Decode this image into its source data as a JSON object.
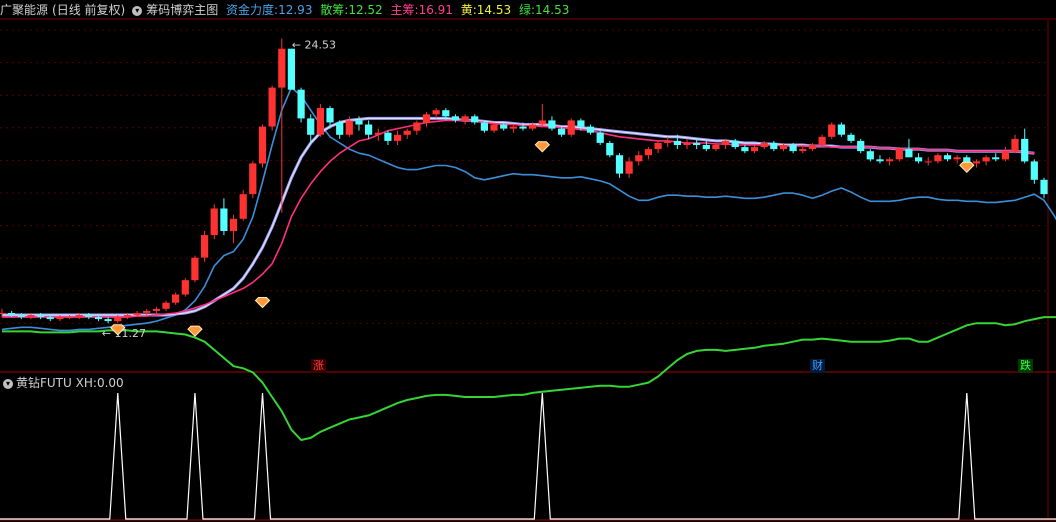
{
  "header": {
    "stock_name": "广聚能源",
    "period": "(日线 前复权)",
    "indicator_name": "筹码博弈主图",
    "fund_power_label": "资金力度:",
    "fund_power_value": "12.93",
    "retail_label": "散筹:",
    "retail_value": "12.52",
    "main_label": "主筹:",
    "main_value": "16.91",
    "yellow_label": "黄:",
    "yellow_value": "14.53",
    "green_label": "绿:",
    "green_value": "14.53",
    "colors": {
      "stock": "#d0d0d0",
      "indicator": "#d0d0d0",
      "fund": "#4aa3e8",
      "retail": "#3fe03f",
      "main": "#ff3f8f",
      "yellow": "#f0f03c",
      "green": "#3fe03f"
    }
  },
  "subheader": {
    "name": "黄钻FUTU",
    "xh_label": "XH:",
    "xh_value": "0.00"
  },
  "events": [
    {
      "label": "涨",
      "color": "#ff4040",
      "bg": "#3a0000"
    },
    {
      "label": "财",
      "color": "#40a0ff",
      "bg": "#001a3a"
    },
    {
      "label": "跌",
      "color": "#40ff40",
      "bg": "#003a00"
    }
  ],
  "chart_data": {
    "type": "line",
    "price_range": [
      9.5,
      26.0
    ],
    "annotations": [
      {
        "text": "24.53",
        "series": "high"
      },
      {
        "text": "11.27",
        "series": "low"
      }
    ],
    "candles": [
      [
        11.6,
        11.8,
        11.4,
        11.6
      ],
      [
        11.6,
        11.7,
        11.4,
        11.5
      ],
      [
        11.5,
        11.6,
        11.3,
        11.4
      ],
      [
        11.4,
        11.6,
        11.3,
        11.5
      ],
      [
        11.5,
        11.6,
        11.3,
        11.4
      ],
      [
        11.4,
        11.5,
        11.2,
        11.3
      ],
      [
        11.3,
        11.5,
        11.2,
        11.4
      ],
      [
        11.4,
        11.5,
        11.3,
        11.4
      ],
      [
        11.4,
        11.6,
        11.3,
        11.5
      ],
      [
        11.5,
        11.6,
        11.3,
        11.4
      ],
      [
        11.4,
        11.5,
        11.2,
        11.3
      ],
      [
        11.3,
        11.4,
        11.1,
        11.2
      ],
      [
        11.2,
        11.5,
        11.1,
        11.4
      ],
      [
        11.4,
        11.6,
        11.3,
        11.5
      ],
      [
        11.5,
        11.7,
        11.4,
        11.6
      ],
      [
        11.6,
        11.8,
        11.5,
        11.7
      ],
      [
        11.7,
        11.9,
        11.5,
        11.8
      ],
      [
        11.8,
        12.2,
        11.7,
        12.1
      ],
      [
        12.1,
        12.6,
        12.0,
        12.5
      ],
      [
        12.5,
        13.3,
        12.4,
        13.2
      ],
      [
        13.2,
        14.4,
        13.1,
        14.3
      ],
      [
        14.3,
        15.6,
        14.1,
        15.4
      ],
      [
        15.4,
        16.9,
        15.2,
        16.7
      ],
      [
        16.7,
        17.2,
        15.4,
        15.6
      ],
      [
        15.6,
        16.4,
        15.0,
        16.2
      ],
      [
        16.2,
        17.6,
        16.1,
        17.4
      ],
      [
        17.4,
        19.0,
        17.2,
        18.9
      ],
      [
        18.9,
        20.8,
        18.7,
        20.7
      ],
      [
        20.7,
        22.7,
        20.5,
        22.6
      ],
      [
        22.6,
        25.0,
        16.5,
        24.5
      ],
      [
        24.5,
        24.5,
        22.5,
        22.5
      ],
      [
        22.5,
        22.6,
        20.9,
        21.1
      ],
      [
        21.1,
        21.3,
        19.9,
        20.3
      ],
      [
        20.3,
        21.8,
        20.2,
        21.6
      ],
      [
        21.6,
        21.7,
        20.6,
        20.9
      ],
      [
        20.9,
        21.0,
        20.1,
        20.3
      ],
      [
        20.3,
        21.2,
        20.2,
        21.0
      ],
      [
        21.0,
        21.2,
        20.5,
        20.8
      ],
      [
        20.8,
        21.0,
        20.1,
        20.3
      ],
      [
        20.3,
        20.6,
        20.0,
        20.4
      ],
      [
        20.4,
        20.5,
        19.8,
        20.0
      ],
      [
        20.0,
        20.5,
        19.8,
        20.3
      ],
      [
        20.3,
        20.6,
        20.1,
        20.5
      ],
      [
        20.5,
        21.0,
        20.3,
        20.9
      ],
      [
        20.9,
        21.4,
        20.7,
        21.3
      ],
      [
        21.3,
        21.6,
        21.1,
        21.5
      ],
      [
        21.5,
        21.6,
        21.0,
        21.2
      ],
      [
        21.2,
        21.3,
        20.9,
        21.0
      ],
      [
        21.0,
        21.3,
        20.8,
        21.2
      ],
      [
        21.2,
        21.3,
        20.8,
        20.9
      ],
      [
        20.9,
        21.0,
        20.4,
        20.5
      ],
      [
        20.5,
        20.9,
        20.4,
        20.8
      ],
      [
        20.8,
        20.9,
        20.5,
        20.6
      ],
      [
        20.6,
        20.8,
        20.4,
        20.7
      ],
      [
        20.7,
        20.9,
        20.5,
        20.6
      ],
      [
        20.6,
        20.9,
        20.5,
        20.8
      ],
      [
        20.8,
        21.8,
        20.7,
        21.0
      ],
      [
        21.0,
        21.2,
        20.5,
        20.6
      ],
      [
        20.6,
        20.7,
        20.2,
        20.3
      ],
      [
        20.3,
        21.1,
        20.2,
        21.0
      ],
      [
        21.0,
        21.1,
        20.5,
        20.7
      ],
      [
        20.7,
        20.8,
        20.3,
        20.4
      ],
      [
        20.4,
        20.5,
        19.8,
        19.9
      ],
      [
        19.9,
        20.0,
        19.2,
        19.3
      ],
      [
        19.3,
        19.4,
        18.2,
        18.4
      ],
      [
        18.4,
        19.2,
        18.2,
        19.0
      ],
      [
        19.0,
        19.5,
        18.8,
        19.3
      ],
      [
        19.3,
        19.7,
        19.1,
        19.6
      ],
      [
        19.6,
        20.0,
        19.4,
        19.9
      ],
      [
        19.9,
        20.2,
        19.7,
        20.0
      ],
      [
        20.0,
        20.3,
        19.6,
        19.8
      ],
      [
        19.8,
        20.1,
        19.6,
        19.9
      ],
      [
        19.9,
        20.1,
        19.6,
        19.8
      ],
      [
        19.8,
        20.0,
        19.5,
        19.6
      ],
      [
        19.6,
        19.9,
        19.5,
        19.8
      ],
      [
        19.8,
        20.1,
        19.6,
        20.0
      ],
      [
        20.0,
        20.1,
        19.6,
        19.7
      ],
      [
        19.7,
        19.8,
        19.4,
        19.5
      ],
      [
        19.5,
        19.8,
        19.4,
        19.7
      ],
      [
        19.7,
        20.0,
        19.6,
        19.9
      ],
      [
        19.9,
        20.0,
        19.5,
        19.6
      ],
      [
        19.6,
        19.9,
        19.5,
        19.8
      ],
      [
        19.8,
        19.9,
        19.4,
        19.5
      ],
      [
        19.5,
        19.8,
        19.4,
        19.6
      ],
      [
        19.6,
        19.9,
        19.5,
        19.8
      ],
      [
        19.8,
        20.3,
        19.7,
        20.2
      ],
      [
        20.2,
        20.9,
        20.1,
        20.8
      ],
      [
        20.8,
        20.9,
        20.2,
        20.3
      ],
      [
        20.3,
        20.4,
        19.9,
        20.0
      ],
      [
        20.0,
        20.1,
        19.4,
        19.5
      ],
      [
        19.5,
        19.6,
        19.0,
        19.1
      ],
      [
        19.1,
        19.3,
        18.9,
        19.0
      ],
      [
        19.0,
        19.2,
        18.8,
        19.1
      ],
      [
        19.1,
        19.7,
        19.0,
        19.6
      ],
      [
        19.6,
        20.1,
        19.5,
        19.2
      ],
      [
        19.2,
        19.4,
        18.9,
        19.0
      ],
      [
        19.0,
        19.2,
        18.8,
        19.0
      ],
      [
        19.0,
        19.4,
        18.9,
        19.3
      ],
      [
        19.3,
        19.4,
        19.0,
        19.1
      ],
      [
        19.1,
        19.3,
        18.9,
        19.2
      ],
      [
        19.2,
        19.3,
        18.8,
        18.9
      ],
      [
        18.9,
        19.1,
        18.7,
        19.0
      ],
      [
        19.0,
        19.3,
        18.8,
        19.2
      ],
      [
        19.2,
        19.4,
        19.0,
        19.1
      ],
      [
        19.1,
        19.7,
        19.0,
        19.5
      ],
      [
        19.5,
        20.3,
        19.4,
        20.1
      ],
      [
        20.1,
        20.6,
        18.9,
        19.0
      ],
      [
        19.0,
        19.1,
        17.9,
        18.1
      ],
      [
        18.1,
        18.2,
        17.2,
        17.4
      ]
    ],
    "series": [
      {
        "name": "资金力度",
        "color": "#3d8ed8",
        "values": [
          10.8,
          10.85,
          10.9,
          10.9,
          10.85,
          10.8,
          10.75,
          10.75,
          10.8,
          10.8,
          10.85,
          10.9,
          10.95,
          11.0,
          11.05,
          11.1,
          11.2,
          11.35,
          11.5,
          11.75,
          12.2,
          12.9,
          13.9,
          14.4,
          14.6,
          15.2,
          16.3,
          18.0,
          19.8,
          21.5,
          22.6,
          22.2,
          21.5,
          20.8,
          20.2,
          19.9,
          19.6,
          19.4,
          19.3,
          19.1,
          18.9,
          18.7,
          18.6,
          18.6,
          18.7,
          18.8,
          18.8,
          18.7,
          18.5,
          18.2,
          18.1,
          18.2,
          18.3,
          18.4,
          18.35,
          18.35,
          18.3,
          18.25,
          18.2,
          18.2,
          18.25,
          18.15,
          18.05,
          17.9,
          17.6,
          17.3,
          17.1,
          17.1,
          17.25,
          17.35,
          17.35,
          17.3,
          17.3,
          17.25,
          17.25,
          17.3,
          17.25,
          17.2,
          17.2,
          17.25,
          17.35,
          17.45,
          17.45,
          17.35,
          17.2,
          17.35,
          17.55,
          17.7,
          17.5,
          17.25,
          17.05,
          17.05,
          17.05,
          17.1,
          17.2,
          17.25,
          17.25,
          17.15,
          17.1,
          17.1,
          17.05,
          17.05,
          17.0,
          17.0,
          17.05,
          17.1,
          17.25,
          17.4,
          17.1,
          16.4,
          15.6
        ]
      },
      {
        "name": "散筹",
        "color": "#35d535",
        "values": [
          10.7,
          10.7,
          10.7,
          10.7,
          10.65,
          10.65,
          10.65,
          10.65,
          10.7,
          10.7,
          10.7,
          10.75,
          10.75,
          10.75,
          10.7,
          10.7,
          10.7,
          10.65,
          10.6,
          10.55,
          10.4,
          10.2,
          9.8,
          9.4,
          9.0,
          8.9,
          8.7,
          8.2,
          7.5,
          6.8,
          5.9,
          5.4,
          5.5,
          5.8,
          6.0,
          6.2,
          6.4,
          6.5,
          6.6,
          6.8,
          7.0,
          7.2,
          7.35,
          7.45,
          7.55,
          7.6,
          7.6,
          7.55,
          7.5,
          7.5,
          7.5,
          7.5,
          7.55,
          7.6,
          7.6,
          7.7,
          7.75,
          7.8,
          7.85,
          7.9,
          7.95,
          8.0,
          8.05,
          8.05,
          8.0,
          8.0,
          8.1,
          8.2,
          8.5,
          8.9,
          9.3,
          9.6,
          9.75,
          9.8,
          9.8,
          9.75,
          9.8,
          9.85,
          9.9,
          10.0,
          10.05,
          10.1,
          10.2,
          10.3,
          10.3,
          10.35,
          10.3,
          10.25,
          10.2,
          10.2,
          10.2,
          10.2,
          10.25,
          10.35,
          10.35,
          10.2,
          10.2,
          10.4,
          10.6,
          10.8,
          11.0,
          11.1,
          11.1,
          11.1,
          11.0,
          11.05,
          11.2,
          11.3,
          11.4,
          11.4,
          11.4,
          11.35,
          11.3,
          11.15,
          11.05,
          10.9,
          11.2,
          11.7,
          12.2,
          12.7
        ]
      },
      {
        "name": "主筹",
        "color": "#ff2f7f",
        "values": [
          11.4,
          11.4,
          11.4,
          11.4,
          11.4,
          11.4,
          11.4,
          11.4,
          11.4,
          11.4,
          11.4,
          11.4,
          11.4,
          11.4,
          11.45,
          11.45,
          11.5,
          11.55,
          11.6,
          11.7,
          11.85,
          12.0,
          12.2,
          12.4,
          12.6,
          12.8,
          13.1,
          13.5,
          14.0,
          15.0,
          16.3,
          17.2,
          17.9,
          18.5,
          19.0,
          19.4,
          19.7,
          20.0,
          20.1,
          20.3,
          20.5,
          20.6,
          20.7,
          20.8,
          20.9,
          20.95,
          21.0,
          21.0,
          21.0,
          20.95,
          20.9,
          20.85,
          20.8,
          20.8,
          20.75,
          20.75,
          20.7,
          20.7,
          20.65,
          20.6,
          20.55,
          20.5,
          20.4,
          20.3,
          20.2,
          20.15,
          20.1,
          20.05,
          20.0,
          20.0,
          19.95,
          19.9,
          19.9,
          19.9,
          19.85,
          19.85,
          19.8,
          19.8,
          19.8,
          19.8,
          19.8,
          19.75,
          19.75,
          19.75,
          19.75,
          19.75,
          19.7,
          19.7,
          19.7,
          19.7,
          19.7,
          19.65,
          19.65,
          19.6,
          19.6,
          19.6,
          19.55,
          19.55,
          19.55,
          19.5,
          19.5,
          19.5,
          19.5,
          19.5,
          19.5,
          19.5,
          19.45,
          19.4
        ]
      },
      {
        "name": "黄",
        "color": "#9aa0f0",
        "values": [
          11.5,
          11.5,
          11.5,
          11.5,
          11.5,
          11.5,
          11.5,
          11.5,
          11.5,
          11.5,
          11.5,
          11.5,
          11.5,
          11.5,
          11.5,
          11.5,
          11.5,
          11.5,
          11.55,
          11.6,
          11.7,
          11.9,
          12.2,
          12.5,
          12.8,
          13.3,
          14.0,
          14.8,
          15.8,
          17.0,
          18.2,
          19.2,
          19.9,
          20.4,
          20.7,
          20.9,
          21.0,
          21.05,
          21.1,
          21.1,
          21.1,
          21.1,
          21.1,
          21.1,
          21.1,
          21.1,
          21.1,
          21.05,
          21.0,
          21.0,
          20.95,
          20.9,
          20.9,
          20.85,
          20.8,
          20.8,
          20.8,
          20.75,
          20.7,
          20.7,
          20.65,
          20.6,
          20.55,
          20.5,
          20.45,
          20.4,
          20.35,
          20.3,
          20.25,
          20.2,
          20.2,
          20.15,
          20.1,
          20.05,
          20.0,
          20.0,
          19.95,
          19.9,
          19.9,
          19.85,
          19.85,
          19.8,
          19.8,
          19.8,
          19.75,
          19.75,
          19.75,
          19.7,
          19.7,
          19.7,
          19.7,
          19.65,
          19.65,
          19.6,
          19.6,
          19.6,
          19.55,
          19.55,
          19.55,
          19.5,
          19.5,
          19.5,
          19.5,
          19.5,
          19.5,
          19.5,
          19.45,
          19.4
        ]
      },
      {
        "name": "绿",
        "color": "#e8e8ff",
        "values": [
          11.5,
          11.5,
          11.5,
          11.5,
          11.5,
          11.5,
          11.5,
          11.5,
          11.5,
          11.5,
          11.5,
          11.5,
          11.5,
          11.5,
          11.5,
          11.5,
          11.5,
          11.5,
          11.55,
          11.6,
          11.7,
          11.9,
          12.2,
          12.5,
          12.8,
          13.3,
          14.0,
          14.8,
          15.8,
          17.0,
          18.2,
          19.2,
          19.9,
          20.4,
          20.7,
          20.9,
          21.0,
          21.05,
          21.1,
          21.1,
          21.1,
          21.1,
          21.1,
          21.1,
          21.1,
          21.1,
          21.1,
          21.05,
          21.0,
          21.0,
          20.95,
          20.9,
          20.9,
          20.85,
          20.8,
          20.8,
          20.8,
          20.75,
          20.7,
          20.7,
          20.65,
          20.6,
          20.55,
          20.5,
          20.45,
          20.4,
          20.35,
          20.3,
          20.25,
          20.2,
          20.2,
          20.15,
          20.1,
          20.05,
          20.0,
          20.0,
          19.95,
          19.9,
          19.9,
          19.85,
          19.85,
          19.8,
          19.8,
          19.8,
          19.75,
          19.75,
          19.75,
          19.7,
          19.7,
          19.7,
          19.7,
          19.65,
          19.65,
          19.6,
          19.6,
          19.6,
          19.55,
          19.55,
          19.55,
          19.5,
          19.5,
          19.5,
          19.5,
          19.5,
          19.5,
          19.5,
          19.45,
          19.4
        ]
      }
    ],
    "diamonds": [
      {
        "index": 12,
        "price": 11.27
      },
      {
        "index": 20,
        "price": 11.2
      },
      {
        "index": 27,
        "price": 12.6
      },
      {
        "index": 56,
        "price": 20.2
      },
      {
        "index": 100,
        "price": 19.2
      }
    ],
    "xh_signals": [
      12,
      20,
      27,
      56,
      100
    ],
    "xh_range": [
      0,
      1
    ]
  }
}
